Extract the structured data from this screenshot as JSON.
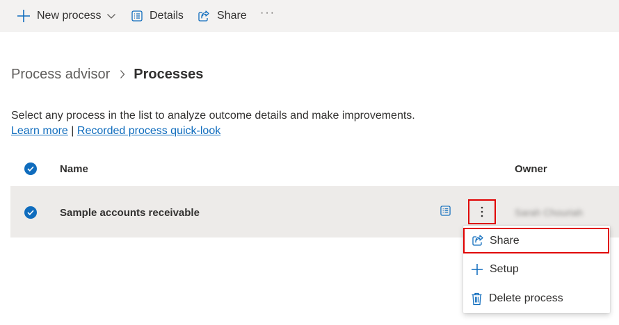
{
  "toolbar": {
    "new_process_label": "New process",
    "details_label": "Details",
    "share_label": "Share",
    "more_label": "···"
  },
  "breadcrumb": {
    "root": "Process advisor",
    "current": "Processes"
  },
  "description": {
    "text": "Select any process in the list to analyze outcome details and make improvements.",
    "learn_more": "Learn more",
    "separator": "|",
    "quick_look": "Recorded process quick-look"
  },
  "table": {
    "columns": {
      "name": "Name",
      "owner": "Owner"
    },
    "rows": [
      {
        "name": "Sample accounts receivable",
        "owner": "Sarah Chouriah",
        "selected": true
      }
    ]
  },
  "context_menu": {
    "items": [
      {
        "label": "Share",
        "icon": "share-icon"
      },
      {
        "label": "Setup",
        "icon": "plus-icon"
      },
      {
        "label": "Delete process",
        "icon": "trash-icon"
      }
    ]
  },
  "colors": {
    "accent": "#0f6cbd",
    "highlight_border": "#e00000",
    "command_bar_bg": "#f3f2f1",
    "selected_row_bg": "#edebe9"
  }
}
